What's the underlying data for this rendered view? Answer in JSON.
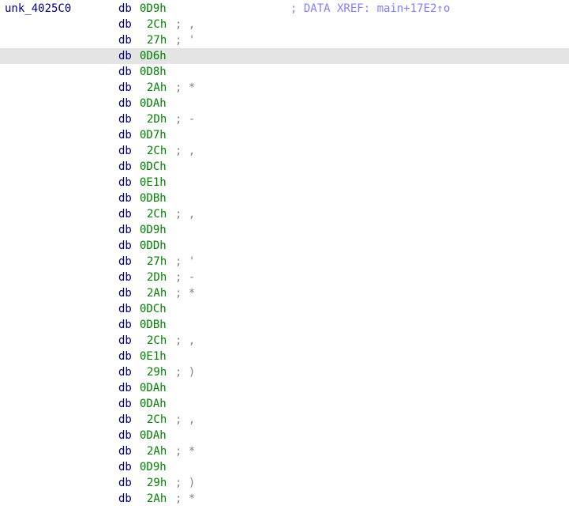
{
  "listing": {
    "label": "unk_4025C0",
    "xref_comment": "; DATA XREF: main+17E2↑o",
    "highlighted_row": 3,
    "rows": [
      {
        "mnem": "db",
        "val": "0D9h",
        "cmt": ""
      },
      {
        "mnem": "db",
        "val": "2Ch",
        "cmt": "; ,"
      },
      {
        "mnem": "db",
        "val": "27h",
        "cmt": "; '"
      },
      {
        "mnem": "db",
        "val": "0D6h",
        "cmt": ""
      },
      {
        "mnem": "db",
        "val": "0D8h",
        "cmt": ""
      },
      {
        "mnem": "db",
        "val": "2Ah",
        "cmt": "; *"
      },
      {
        "mnem": "db",
        "val": "0DAh",
        "cmt": ""
      },
      {
        "mnem": "db",
        "val": "2Dh",
        "cmt": "; -"
      },
      {
        "mnem": "db",
        "val": "0D7h",
        "cmt": ""
      },
      {
        "mnem": "db",
        "val": "2Ch",
        "cmt": "; ,"
      },
      {
        "mnem": "db",
        "val": "0DCh",
        "cmt": ""
      },
      {
        "mnem": "db",
        "val": "0E1h",
        "cmt": ""
      },
      {
        "mnem": "db",
        "val": "0DBh",
        "cmt": ""
      },
      {
        "mnem": "db",
        "val": "2Ch",
        "cmt": "; ,"
      },
      {
        "mnem": "db",
        "val": "0D9h",
        "cmt": ""
      },
      {
        "mnem": "db",
        "val": "0DDh",
        "cmt": ""
      },
      {
        "mnem": "db",
        "val": "27h",
        "cmt": "; '"
      },
      {
        "mnem": "db",
        "val": "2Dh",
        "cmt": "; -"
      },
      {
        "mnem": "db",
        "val": "2Ah",
        "cmt": "; *"
      },
      {
        "mnem": "db",
        "val": "0DCh",
        "cmt": ""
      },
      {
        "mnem": "db",
        "val": "0DBh",
        "cmt": ""
      },
      {
        "mnem": "db",
        "val": "2Ch",
        "cmt": "; ,"
      },
      {
        "mnem": "db",
        "val": "0E1h",
        "cmt": ""
      },
      {
        "mnem": "db",
        "val": "29h",
        "cmt": "; )"
      },
      {
        "mnem": "db",
        "val": "0DAh",
        "cmt": ""
      },
      {
        "mnem": "db",
        "val": "0DAh",
        "cmt": ""
      },
      {
        "mnem": "db",
        "val": "2Ch",
        "cmt": "; ,"
      },
      {
        "mnem": "db",
        "val": "0DAh",
        "cmt": ""
      },
      {
        "mnem": "db",
        "val": "2Ah",
        "cmt": "; *"
      },
      {
        "mnem": "db",
        "val": "0D9h",
        "cmt": ""
      },
      {
        "mnem": "db",
        "val": "29h",
        "cmt": "; )"
      },
      {
        "mnem": "db",
        "val": "2Ah",
        "cmt": "; *"
      }
    ]
  }
}
